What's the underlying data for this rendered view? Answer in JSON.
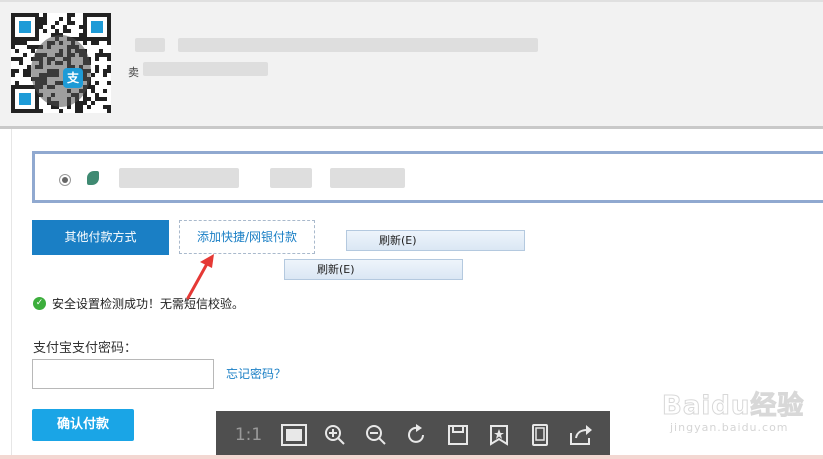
{
  "header": {
    "seller_prefix": "卖"
  },
  "qr": {
    "logo_char": "支"
  },
  "payment": {
    "other_methods_label": "其他付款方式",
    "add_quick_label": "添加快捷/网银付款",
    "refresh_label_1": "刷新(E)",
    "refresh_label_2": "刷新(E)"
  },
  "security": {
    "status_text": "安全设置检测成功！无需短信校验。"
  },
  "password": {
    "label": "支付宝支付密码：",
    "value": "",
    "forgot_label": "忘记密码？"
  },
  "confirm_label": "确认付款",
  "viewer": {
    "ratio_label": "1:1",
    "icons": [
      "fit-screen-icon",
      "zoom-in-icon",
      "zoom-out-icon",
      "rotate-icon",
      "save-icon",
      "favorite-icon",
      "mobile-icon",
      "share-icon"
    ]
  },
  "watermark": {
    "brand": "Baidu经验",
    "url": "jingyan.baidu.com"
  },
  "colors": {
    "primary_blue": "#1a7fc5",
    "confirm_blue": "#1aa5e6",
    "success_green": "#3cae3c",
    "arrow_red": "#e53935",
    "selected_border": "#90a9d0"
  }
}
